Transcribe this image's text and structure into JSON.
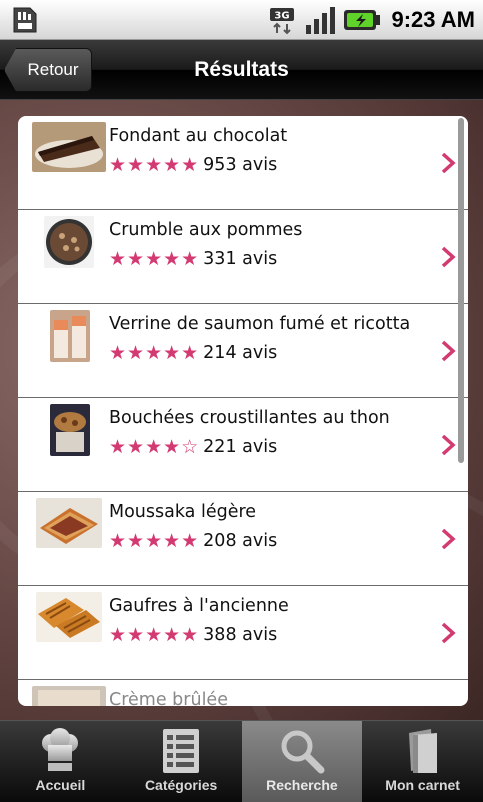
{
  "status_bar": {
    "network": "3G",
    "time": "9:23 AM"
  },
  "header": {
    "back_label": "Retour",
    "title": "Résultats"
  },
  "results": [
    {
      "title": "Fondant au chocolat",
      "stars": "★★★★★",
      "reviews": "953 avis"
    },
    {
      "title": "Crumble aux pommes",
      "stars": "★★★★★",
      "reviews": "331 avis"
    },
    {
      "title": "Verrine de saumon fumé et ricotta",
      "stars": "★★★★★",
      "reviews": "214 avis"
    },
    {
      "title": "Bouchées croustillantes au thon",
      "stars": "★★★★☆",
      "reviews": "221 avis"
    },
    {
      "title": "Moussaka légère",
      "stars": "★★★★★",
      "reviews": "208 avis"
    },
    {
      "title": "Gaufres à l'ancienne",
      "stars": "★★★★★",
      "reviews": "388 avis"
    },
    {
      "title": "Crème brûlée",
      "stars": "",
      "reviews": ""
    }
  ],
  "tabs": [
    {
      "label": "Accueil",
      "icon": "chef-hat-icon"
    },
    {
      "label": "Catégories",
      "icon": "list-icon"
    },
    {
      "label": "Recherche",
      "icon": "search-icon",
      "active": true
    },
    {
      "label": "Mon carnet",
      "icon": "book-icon"
    }
  ],
  "colors": {
    "accent": "#d23a71",
    "titlebar": "#1a1a1a"
  }
}
